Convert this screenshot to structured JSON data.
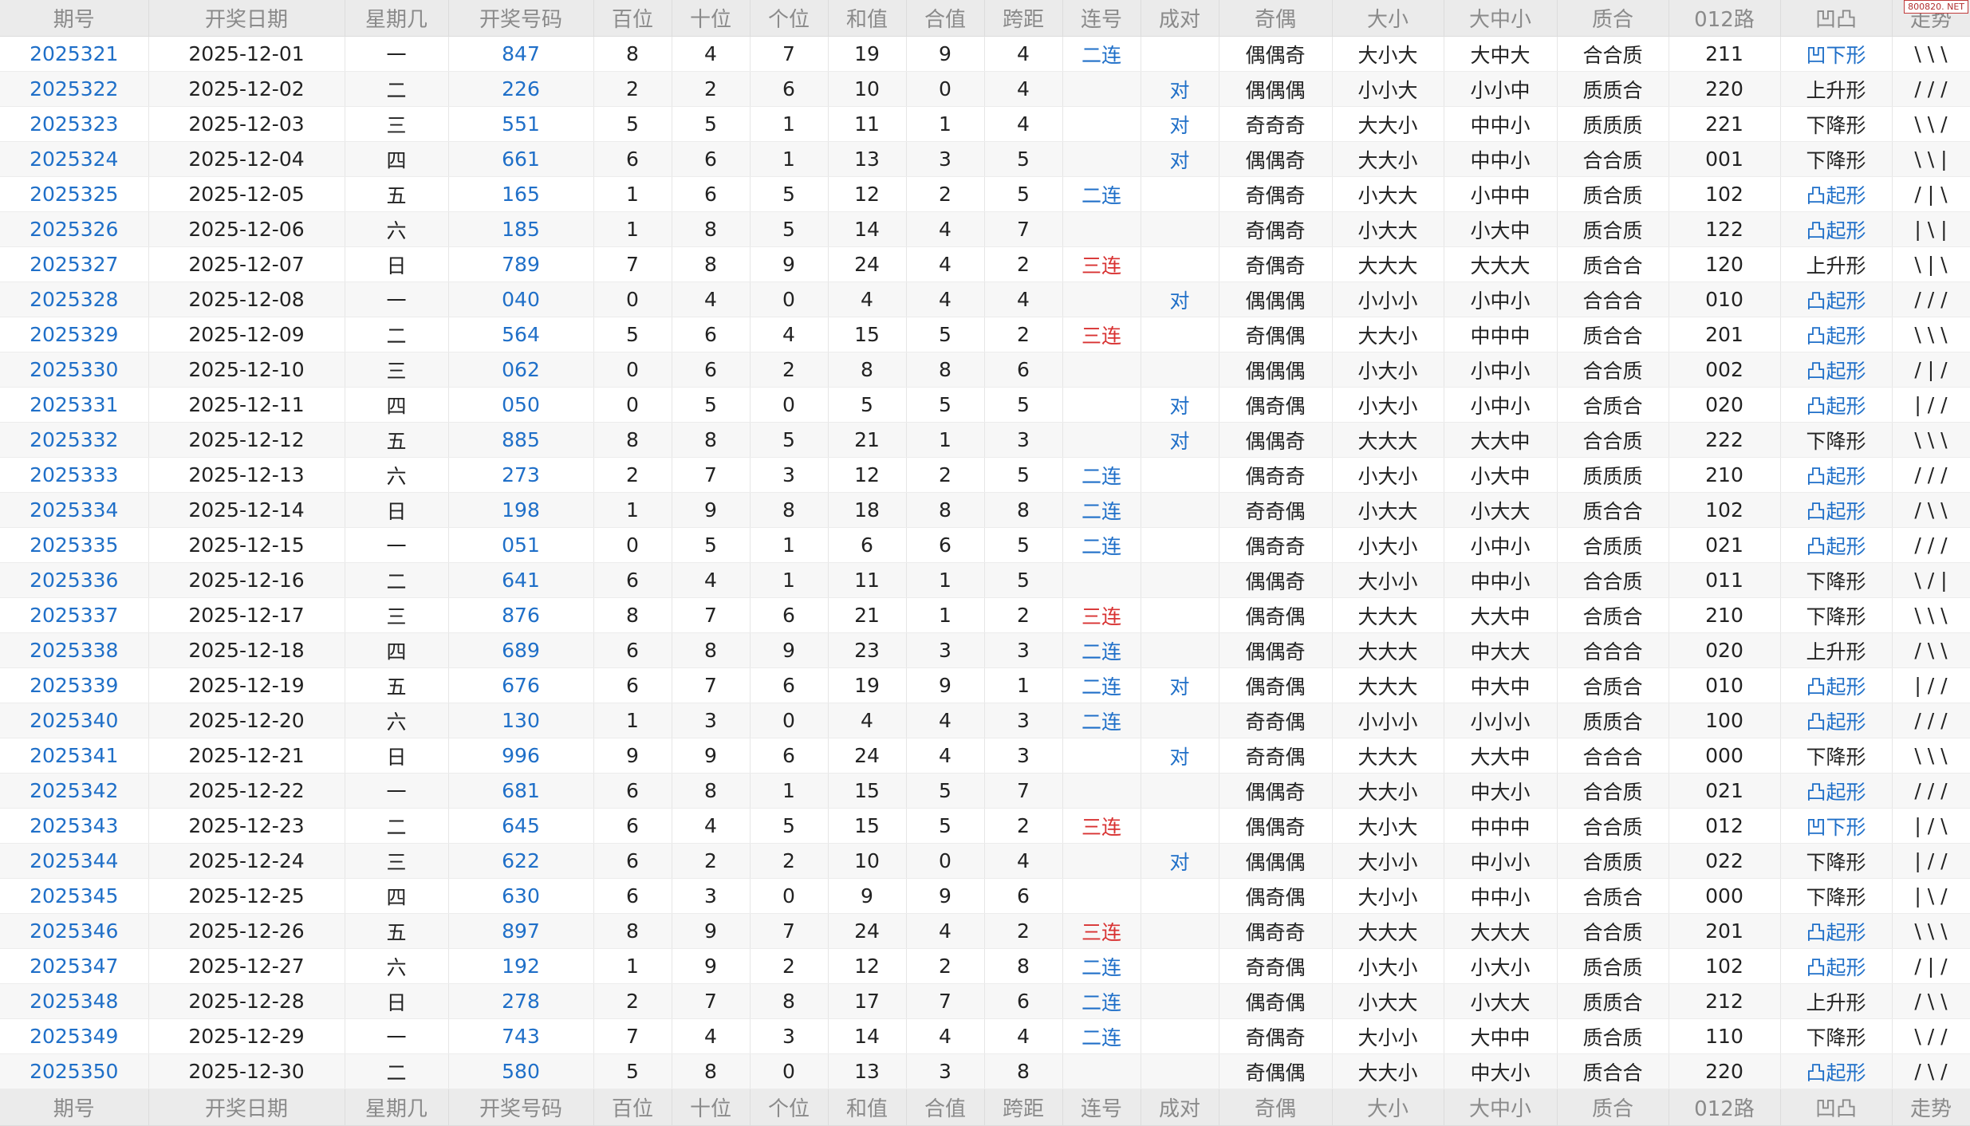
{
  "corner_tag": "800820. NET",
  "headers": [
    "期号",
    "开奖日期",
    "星期几",
    "开奖号码",
    "百位",
    "十位",
    "个位",
    "和值",
    "合值",
    "跨距",
    "连号",
    "成对",
    "奇偶",
    "大小",
    "大中小",
    "质合",
    "012路",
    "凹凸",
    "走势"
  ],
  "colors": {
    "blue": "#1f6fc8",
    "red": "#d83232",
    "header_bg": "#ebebeb"
  },
  "rows": [
    [
      "2025321",
      "2025-12-01",
      "一",
      "847",
      "8",
      "4",
      "7",
      "19",
      "9",
      "4",
      "二连",
      "",
      "偶偶奇",
      "大小大",
      "大中大",
      "合合质",
      "211",
      "凹下形",
      "\\ \\ \\"
    ],
    [
      "2025322",
      "2025-12-02",
      "二",
      "226",
      "2",
      "2",
      "6",
      "10",
      "0",
      "4",
      "",
      "对",
      "偶偶偶",
      "小小大",
      "小小中",
      "质质合",
      "220",
      "上升形",
      "/ / /"
    ],
    [
      "2025323",
      "2025-12-03",
      "三",
      "551",
      "5",
      "5",
      "1",
      "11",
      "1",
      "4",
      "",
      "对",
      "奇奇奇",
      "大大小",
      "中中小",
      "质质质",
      "221",
      "下降形",
      "\\ \\ /"
    ],
    [
      "2025324",
      "2025-12-04",
      "四",
      "661",
      "6",
      "6",
      "1",
      "13",
      "3",
      "5",
      "",
      "对",
      "偶偶奇",
      "大大小",
      "中中小",
      "合合质",
      "001",
      "下降形",
      "\\ \\ |"
    ],
    [
      "2025325",
      "2025-12-05",
      "五",
      "165",
      "1",
      "6",
      "5",
      "12",
      "2",
      "5",
      "二连",
      "",
      "奇偶奇",
      "小大大",
      "小中中",
      "质合质",
      "102",
      "凸起形",
      "/ | \\"
    ],
    [
      "2025326",
      "2025-12-06",
      "六",
      "185",
      "1",
      "8",
      "5",
      "14",
      "4",
      "7",
      "",
      "",
      "奇偶奇",
      "小大大",
      "小大中",
      "质合质",
      "122",
      "凸起形",
      "| \\ |"
    ],
    [
      "2025327",
      "2025-12-07",
      "日",
      "789",
      "7",
      "8",
      "9",
      "24",
      "4",
      "2",
      "三连",
      "",
      "奇偶奇",
      "大大大",
      "大大大",
      "质合合",
      "120",
      "上升形",
      "\\ | \\"
    ],
    [
      "2025328",
      "2025-12-08",
      "一",
      "040",
      "0",
      "4",
      "0",
      "4",
      "4",
      "4",
      "",
      "对",
      "偶偶偶",
      "小小小",
      "小中小",
      "合合合",
      "010",
      "凸起形",
      "/ / /"
    ],
    [
      "2025329",
      "2025-12-09",
      "二",
      "564",
      "5",
      "6",
      "4",
      "15",
      "5",
      "2",
      "三连",
      "",
      "奇偶偶",
      "大大小",
      "中中中",
      "质合合",
      "201",
      "凸起形",
      "\\ \\ \\"
    ],
    [
      "2025330",
      "2025-12-10",
      "三",
      "062",
      "0",
      "6",
      "2",
      "8",
      "8",
      "6",
      "",
      "",
      "偶偶偶",
      "小大小",
      "小中小",
      "合合质",
      "002",
      "凸起形",
      "/ | /"
    ],
    [
      "2025331",
      "2025-12-11",
      "四",
      "050",
      "0",
      "5",
      "0",
      "5",
      "5",
      "5",
      "",
      "对",
      "偶奇偶",
      "小大小",
      "小中小",
      "合质合",
      "020",
      "凸起形",
      "| / /"
    ],
    [
      "2025332",
      "2025-12-12",
      "五",
      "885",
      "8",
      "8",
      "5",
      "21",
      "1",
      "3",
      "",
      "对",
      "偶偶奇",
      "大大大",
      "大大中",
      "合合质",
      "222",
      "下降形",
      "\\ \\ \\"
    ],
    [
      "2025333",
      "2025-12-13",
      "六",
      "273",
      "2",
      "7",
      "3",
      "12",
      "2",
      "5",
      "二连",
      "",
      "偶奇奇",
      "小大小",
      "小大中",
      "质质质",
      "210",
      "凸起形",
      "/ / /"
    ],
    [
      "2025334",
      "2025-12-14",
      "日",
      "198",
      "1",
      "9",
      "8",
      "18",
      "8",
      "8",
      "二连",
      "",
      "奇奇偶",
      "小大大",
      "小大大",
      "质合合",
      "102",
      "凸起形",
      "/ \\ \\"
    ],
    [
      "2025335",
      "2025-12-15",
      "一",
      "051",
      "0",
      "5",
      "1",
      "6",
      "6",
      "5",
      "二连",
      "",
      "偶奇奇",
      "小大小",
      "小中小",
      "合质质",
      "021",
      "凸起形",
      "/ / /"
    ],
    [
      "2025336",
      "2025-12-16",
      "二",
      "641",
      "6",
      "4",
      "1",
      "11",
      "1",
      "5",
      "",
      "",
      "偶偶奇",
      "大小小",
      "中中小",
      "合合质",
      "011",
      "下降形",
      "\\ / |"
    ],
    [
      "2025337",
      "2025-12-17",
      "三",
      "876",
      "8",
      "7",
      "6",
      "21",
      "1",
      "2",
      "三连",
      "",
      "偶奇偶",
      "大大大",
      "大大中",
      "合质合",
      "210",
      "下降形",
      "\\ \\ \\"
    ],
    [
      "2025338",
      "2025-12-18",
      "四",
      "689",
      "6",
      "8",
      "9",
      "23",
      "3",
      "3",
      "二连",
      "",
      "偶偶奇",
      "大大大",
      "中大大",
      "合合合",
      "020",
      "上升形",
      "/ \\ \\"
    ],
    [
      "2025339",
      "2025-12-19",
      "五",
      "676",
      "6",
      "7",
      "6",
      "19",
      "9",
      "1",
      "二连",
      "对",
      "偶奇偶",
      "大大大",
      "中大中",
      "合质合",
      "010",
      "凸起形",
      "| / /"
    ],
    [
      "2025340",
      "2025-12-20",
      "六",
      "130",
      "1",
      "3",
      "0",
      "4",
      "4",
      "3",
      "二连",
      "",
      "奇奇偶",
      "小小小",
      "小小小",
      "质质合",
      "100",
      "凸起形",
      "/ / /"
    ],
    [
      "2025341",
      "2025-12-21",
      "日",
      "996",
      "9",
      "9",
      "6",
      "24",
      "4",
      "3",
      "",
      "对",
      "奇奇偶",
      "大大大",
      "大大中",
      "合合合",
      "000",
      "下降形",
      "\\ \\ \\"
    ],
    [
      "2025342",
      "2025-12-22",
      "一",
      "681",
      "6",
      "8",
      "1",
      "15",
      "5",
      "7",
      "",
      "",
      "偶偶奇",
      "大大小",
      "中大小",
      "合合质",
      "021",
      "凸起形",
      "/ / /"
    ],
    [
      "2025343",
      "2025-12-23",
      "二",
      "645",
      "6",
      "4",
      "5",
      "15",
      "5",
      "2",
      "三连",
      "",
      "偶偶奇",
      "大小大",
      "中中中",
      "合合质",
      "012",
      "凹下形",
      "| / \\"
    ],
    [
      "2025344",
      "2025-12-24",
      "三",
      "622",
      "6",
      "2",
      "2",
      "10",
      "0",
      "4",
      "",
      "对",
      "偶偶偶",
      "大小小",
      "中小小",
      "合质质",
      "022",
      "下降形",
      "| / /"
    ],
    [
      "2025345",
      "2025-12-25",
      "四",
      "630",
      "6",
      "3",
      "0",
      "9",
      "9",
      "6",
      "",
      "",
      "偶奇偶",
      "大小小",
      "中中小",
      "合质合",
      "000",
      "下降形",
      "| \\ /"
    ],
    [
      "2025346",
      "2025-12-26",
      "五",
      "897",
      "8",
      "9",
      "7",
      "24",
      "4",
      "2",
      "三连",
      "",
      "偶奇奇",
      "大大大",
      "大大大",
      "合合质",
      "201",
      "凸起形",
      "\\ \\ \\"
    ],
    [
      "2025347",
      "2025-12-27",
      "六",
      "192",
      "1",
      "9",
      "2",
      "12",
      "2",
      "8",
      "二连",
      "",
      "奇奇偶",
      "小大小",
      "小大小",
      "质合质",
      "102",
      "凸起形",
      "/ | /"
    ],
    [
      "2025348",
      "2025-12-28",
      "日",
      "278",
      "2",
      "7",
      "8",
      "17",
      "7",
      "6",
      "二连",
      "",
      "偶奇偶",
      "小大大",
      "小大大",
      "质质合",
      "212",
      "上升形",
      "/ \\ \\"
    ],
    [
      "2025349",
      "2025-12-29",
      "一",
      "743",
      "7",
      "4",
      "3",
      "14",
      "4",
      "4",
      "二连",
      "",
      "奇偶奇",
      "大小小",
      "大中中",
      "质合质",
      "110",
      "下降形",
      "\\ / /"
    ],
    [
      "2025350",
      "2025-12-30",
      "二",
      "580",
      "5",
      "8",
      "0",
      "13",
      "3",
      "8",
      "",
      "",
      "奇偶偶",
      "大大小",
      "中大小",
      "质合合",
      "220",
      "凸起形",
      "/ \\ /"
    ]
  ]
}
